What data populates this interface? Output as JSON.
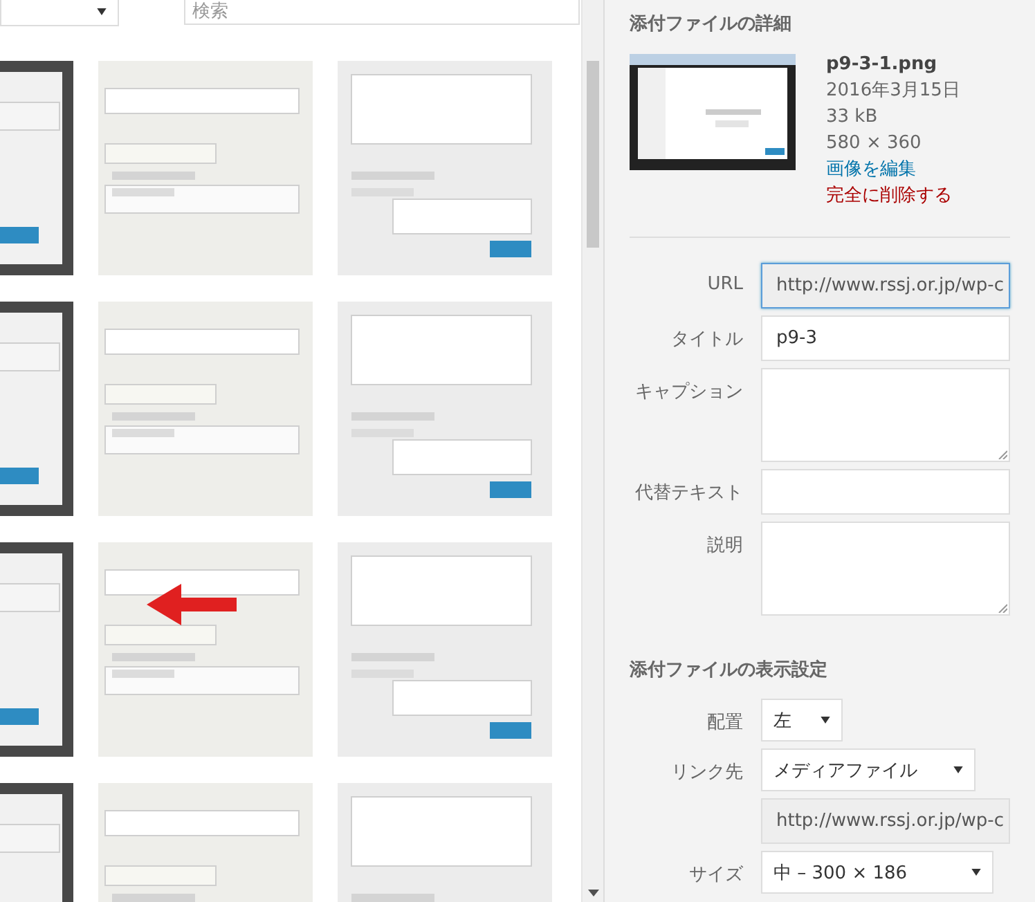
{
  "toolbar": {
    "search": {
      "placeholder": "検索"
    }
  },
  "details": {
    "heading": "添付ファイルの詳細",
    "filename": "p9-3-1.png",
    "date": "2016年3月15日",
    "size": "33 kB",
    "dimensions": "580 × 360",
    "edit_link": "画像を編集",
    "delete_link": "完全に削除する"
  },
  "fields": [
    {
      "label": "URL",
      "kind": "readonly",
      "value": "http://www.rssj.or.jp/wp-c",
      "focused": true
    },
    {
      "label": "タイトル",
      "kind": "text",
      "value": "p9-3",
      "focused": false
    },
    {
      "label": "キャプション",
      "kind": "textarea",
      "focused": false
    },
    {
      "label": "代替テキスト",
      "kind": "text",
      "focused": false
    },
    {
      "label": "説明",
      "kind": "textarea",
      "focused": false
    }
  ],
  "display_settings": {
    "heading": "添付ファイルの表示設定",
    "rows": [
      {
        "label": "配置",
        "kind": "select",
        "value": "左"
      },
      {
        "label": "リンク先",
        "kind": "select",
        "value": "メディアファイル"
      },
      {
        "kind": "readonly",
        "value": "http://www.rssj.or.jp/wp-c"
      },
      {
        "label": "サイズ",
        "kind": "select",
        "value": "中 – 300 × 186"
      }
    ]
  }
}
